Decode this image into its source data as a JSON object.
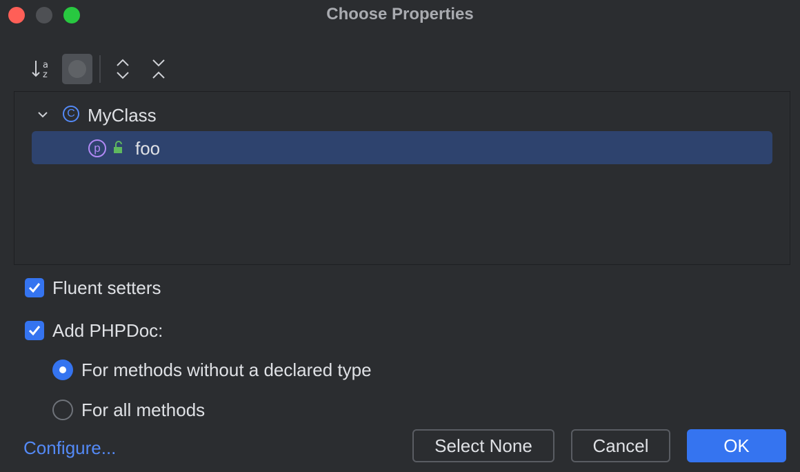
{
  "window": {
    "title": "Choose Properties",
    "controls": [
      "close",
      "minimize",
      "maximize"
    ]
  },
  "toolbar": {
    "buttons": [
      {
        "icon": "sort-alphabetically-icon"
      },
      {
        "icon": "group-toggle-icon",
        "pressed": true
      },
      {
        "icon": "expand-all-icon"
      },
      {
        "icon": "collapse-all-icon"
      }
    ]
  },
  "tree": {
    "class_node": {
      "name": "MyClass",
      "icon_letter": "C",
      "expanded": true
    },
    "property_node": {
      "name": "foo",
      "icon_letter": "p",
      "selected": true
    }
  },
  "options": {
    "fluent_setters": {
      "label": "Fluent setters",
      "checked": true
    },
    "add_phpdoc": {
      "label": "Add PHPDoc:",
      "checked": true
    },
    "phpdoc_mode": {
      "options": [
        "For methods without a declared type",
        "For all methods"
      ],
      "selected": "For methods without a declared type"
    }
  },
  "footer": {
    "configure_link": "Configure...",
    "select_none": "Select None",
    "cancel": "Cancel",
    "ok": "OK"
  },
  "colors": {
    "accent": "#3574f0",
    "selection": "#2e436e",
    "class_icon": "#548af7",
    "property_icon": "#b189f5",
    "lock_icon": "#5fb85f"
  }
}
